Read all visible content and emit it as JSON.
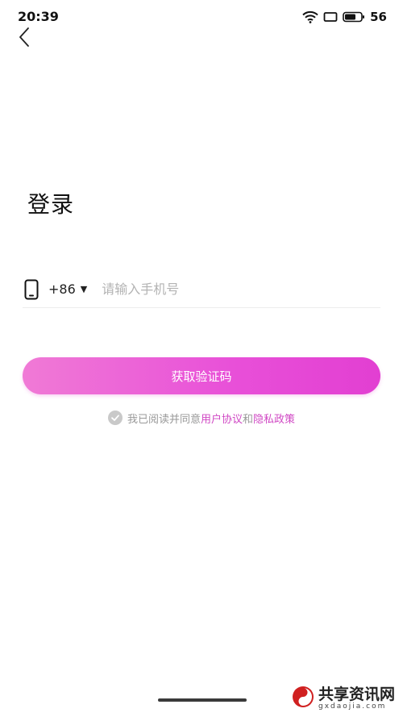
{
  "status_bar": {
    "time": "20:39",
    "battery": "56",
    "icons": [
      "wifi-icon",
      "screen-rotate-icon",
      "battery-icon"
    ]
  },
  "nav": {
    "back_icon": "chevron-left-icon"
  },
  "login": {
    "title": "登录",
    "country_code": "+86",
    "caret": "▼",
    "phone_placeholder": "请输入手机号",
    "phone_value": "",
    "submit_label": "获取验证码"
  },
  "agreement": {
    "prefix": "我已阅读并同意",
    "user_agreement": "用户协议",
    "and": "和",
    "privacy_policy": "隐私政策"
  },
  "watermark": {
    "text": "共享资讯网",
    "subtext": "gxdaojia.com"
  },
  "colors": {
    "accent": "#e84fd8",
    "link": "#d048c4",
    "placeholder": "#b3b3b3"
  }
}
